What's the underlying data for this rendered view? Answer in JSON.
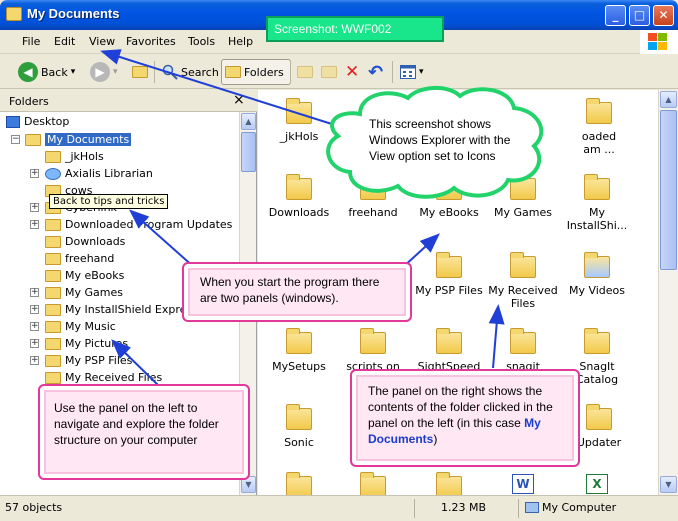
{
  "window": {
    "title": "My Documents",
    "badge": "Screenshot: WWF002",
    "minimize_glyph": "_",
    "maximize_glyph": "□",
    "close_glyph": "✕"
  },
  "menubar": {
    "items": [
      "File",
      "Edit",
      "View",
      "Favorites",
      "Tools",
      "Help"
    ]
  },
  "toolbar": {
    "back_label": "Back",
    "search_label": "Search",
    "folders_label": "Folders",
    "back_glyph": "◀",
    "forward_glyph": "▶",
    "dropdown_glyph": "▾",
    "delete_glyph": "✕",
    "undo_glyph": "↶"
  },
  "folders_pane": {
    "header": "Folders",
    "close_glyph": "×",
    "tooltip": "Back to tips and tricks",
    "tree": [
      {
        "label": "Desktop",
        "expander": ""
      },
      {
        "label": "My Documents",
        "expander": "−"
      },
      {
        "label": "_jkHols",
        "expander": ""
      },
      {
        "label": "Axialis Librarian",
        "expander": "+"
      },
      {
        "label": "cows",
        "expander": ""
      },
      {
        "label": "Cyberlink",
        "expander": "+"
      },
      {
        "label": "Downloaded Program Updates",
        "expander": "+"
      },
      {
        "label": "Downloads",
        "expander": ""
      },
      {
        "label": "freehand",
        "expander": ""
      },
      {
        "label": "My eBooks",
        "expander": ""
      },
      {
        "label": "My Games",
        "expander": "+"
      },
      {
        "label": "My InstallShield Express",
        "expander": "+"
      },
      {
        "label": "My Music",
        "expander": "+"
      },
      {
        "label": "My Pictures",
        "expander": "+"
      },
      {
        "label": "My PSP Files",
        "expander": "+"
      },
      {
        "label": "My Received Files",
        "expander": ""
      }
    ]
  },
  "files_pane": {
    "items": [
      {
        "label": "_jkHols"
      },
      {
        "label": "oaded"
      },
      {
        "label": "am ..."
      },
      {
        "label": "Downloads"
      },
      {
        "label": "freehand"
      },
      {
        "label": "My eBooks"
      },
      {
        "label": "My Games"
      },
      {
        "label": "My InstallShi..."
      },
      {
        "label": "My PSP Files"
      },
      {
        "label": "My Received Files"
      },
      {
        "label": "My Videos"
      },
      {
        "label": "MySetups"
      },
      {
        "label": "scripts on"
      },
      {
        "label": "SightSpeed"
      },
      {
        "label": "snagit"
      },
      {
        "label": "SnagIt Catalog"
      },
      {
        "label": "Sonic"
      },
      {
        "label": "Updater"
      }
    ]
  },
  "statusbar": {
    "objects": "57 objects",
    "size": "1.23 MB",
    "location": "My Computer"
  },
  "annotations": {
    "cloud": "This screenshot shows Windows Explorer with the View option set to Icons",
    "panels": "When you start the program there are two panels (windows).",
    "left_panel": "Use the panel on the left to navigate and explore the folder structure on your computer",
    "right_panel_prefix": "The panel on the right shows the contents of the folder clicked in the panel on the left (in this case",
    "right_panel_highlight": "My Documents",
    "right_panel_suffix": ")"
  },
  "colors": {
    "titlebar": "#0054e3",
    "selection": "#316ac5",
    "badge": "#19e58a",
    "note_border": "#e1389a",
    "cloud_border": "#22d36b",
    "arrow": "#1f3fd6"
  }
}
